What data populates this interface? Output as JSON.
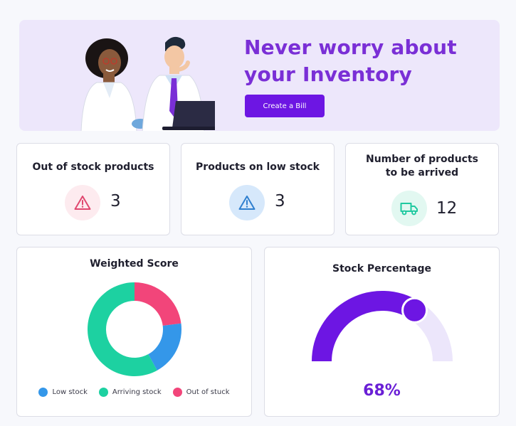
{
  "banner": {
    "title_line1": "Never worry about",
    "title_line2": "your Inventory",
    "button_label": "Create a Bill",
    "colors": {
      "background": "#ede7fb",
      "title": "#7a2fd6",
      "button": "#6d16e3"
    }
  },
  "stats": [
    {
      "title": "Out of stock products",
      "value": "3",
      "icon": "warning-triangle-icon",
      "icon_color": "#e0486f",
      "icon_bg": "#fdebef"
    },
    {
      "title": "Products on low stock",
      "value": "3",
      "icon": "warning-triangle-icon",
      "icon_color": "#2f7fcf",
      "icon_bg": "#d6e8fb"
    },
    {
      "title_line1": "Number of products",
      "title_line2": "to be arrived",
      "value": "12",
      "icon": "truck-icon",
      "icon_color": "#1fc9a0",
      "icon_bg": "#e2f8f1"
    }
  ],
  "weighted_score": {
    "title": "Weighted Score",
    "legend": [
      {
        "label": "Low stock",
        "color": "#3497e9"
      },
      {
        "label": "Arriving stock",
        "color": "#1dd1a1"
      },
      {
        "label": "Out of stuck",
        "color": "#f2457a"
      }
    ]
  },
  "stock_percentage": {
    "title": "Stock Percentage",
    "value_label": "68%",
    "value": 0.68,
    "colors": {
      "fill": "#6d16e3",
      "track": "#ece6fb"
    }
  },
  "chart_data": {
    "type": "pie",
    "title": "Weighted Score",
    "categories": [
      "Out of stuck",
      "Low stock",
      "Arriving stock"
    ],
    "values": [
      23,
      19,
      58
    ],
    "colors": [
      "#f2457a",
      "#3497e9",
      "#1dd1a1"
    ],
    "donut": true,
    "legend": "bottom"
  }
}
